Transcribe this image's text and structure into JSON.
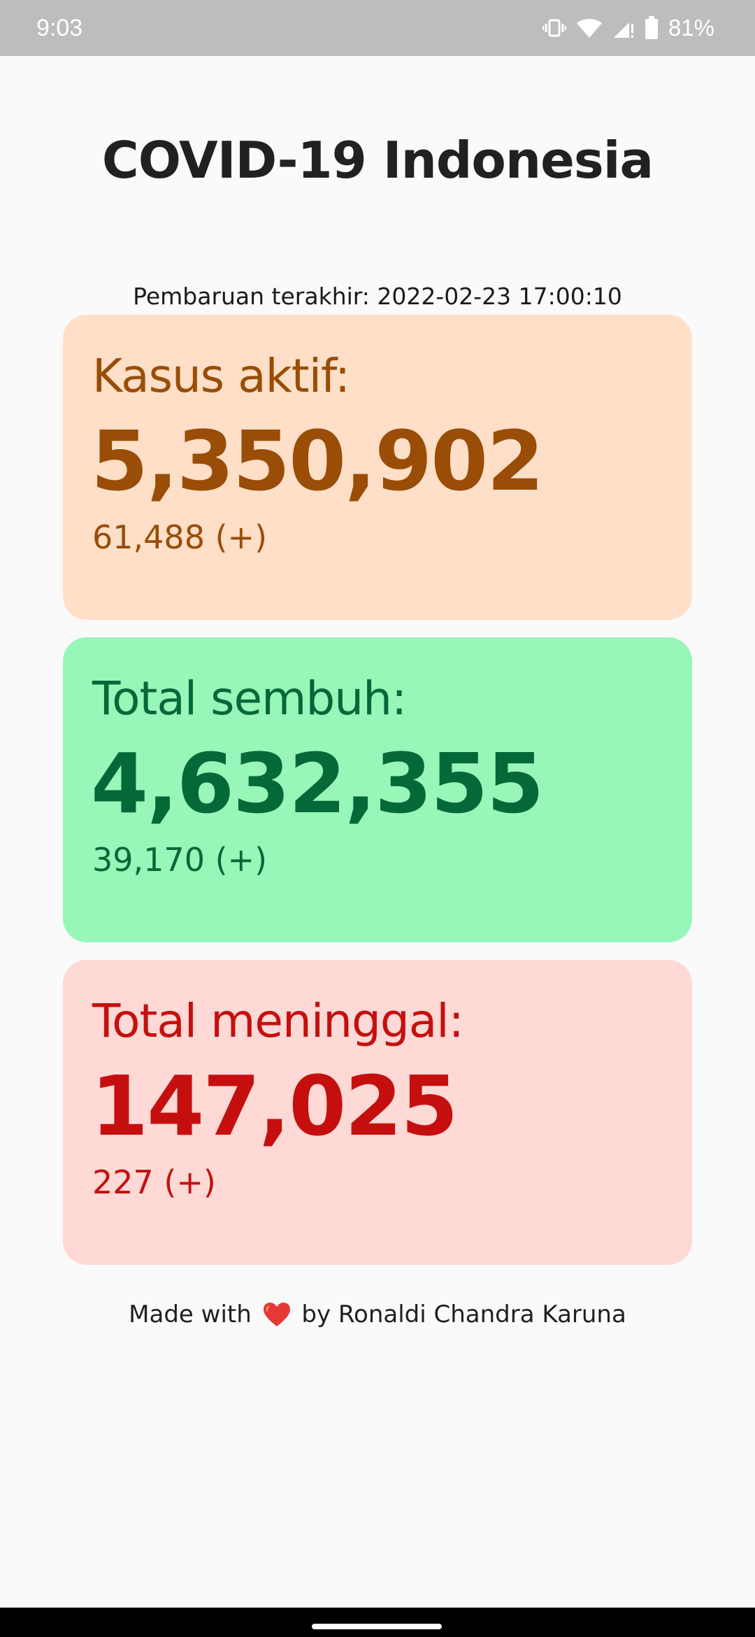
{
  "status_bar": {
    "time": "9:03",
    "battery_percent": "81%",
    "icons": [
      "vibrate-icon",
      "wifi-icon",
      "signal-icon",
      "battery-icon"
    ]
  },
  "app": {
    "title": "COVID-19 Indonesia",
    "last_update": "Pembaruan terakhir: 2022-02-23 17:00:10"
  },
  "cards": {
    "active": {
      "label": "Kasus aktif:",
      "value": "5,350,902",
      "delta": "61,488 (+)",
      "bg_color": "#ffdfc8",
      "text_color": "#9a4d06"
    },
    "recovered": {
      "label": "Total sembuh:",
      "value": "4,632,355",
      "delta": "39,170 (+)",
      "bg_color": "#99f6b9",
      "text_color": "#046838"
    },
    "deaths": {
      "label": "Total meninggal:",
      "value": "147,025",
      "delta": "227 (+)",
      "bg_color": "#fed9d5",
      "text_color": "#c50f0f"
    }
  },
  "footer": {
    "made_with": "Made with",
    "by_author": "by Ronaldi Chandra Karuna",
    "icon": "heart-icon"
  }
}
